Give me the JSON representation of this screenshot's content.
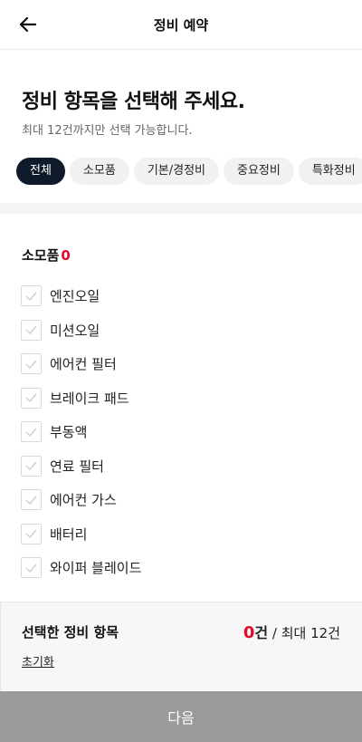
{
  "header": {
    "title": "정비 예약"
  },
  "intro": {
    "headline": "정비 항목을 선택해 주세요.",
    "subtext": "최대 12건까지만 선택 가능합니다."
  },
  "tabs": [
    {
      "label": "전체",
      "active": true
    },
    {
      "label": "소모품",
      "active": false
    },
    {
      "label": "기본/경정비",
      "active": false
    },
    {
      "label": "중요정비",
      "active": false
    },
    {
      "label": "특화정비",
      "active": false
    }
  ],
  "section": {
    "title": "소모품",
    "count": "0"
  },
  "items": [
    {
      "label": "엔진오일",
      "checked": false
    },
    {
      "label": "미션오일",
      "checked": false
    },
    {
      "label": "에어컨 필터",
      "checked": false
    },
    {
      "label": "브레이크 패드",
      "checked": false
    },
    {
      "label": "부동액",
      "checked": false
    },
    {
      "label": "연료 필터",
      "checked": false
    },
    {
      "label": "에어컨 가스",
      "checked": false
    },
    {
      "label": "배터리",
      "checked": false
    },
    {
      "label": "와이퍼 블레이드",
      "checked": false
    }
  ],
  "summary": {
    "title": "선택한 정비 항목",
    "count": "0",
    "count_unit": "건",
    "max_text": "/ 최대 12건",
    "reset_label": "초기화"
  },
  "footer": {
    "next_label": "다음"
  },
  "colors": {
    "accent_red": "#e30a2c",
    "active_chip": "#0f1b2a",
    "next_button_disabled": "#9a9a9a"
  }
}
